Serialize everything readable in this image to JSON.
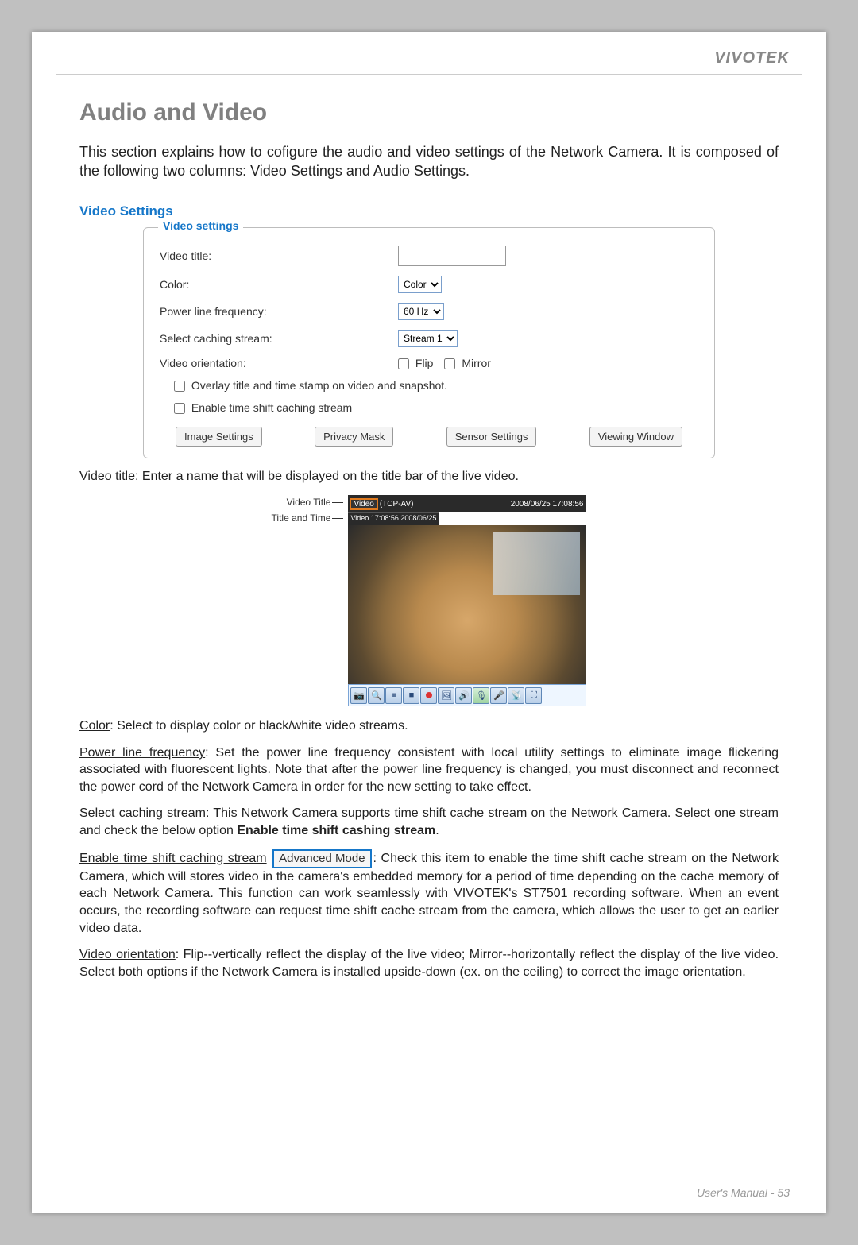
{
  "brand": "VIVOTEK",
  "h1": "Audio and Video",
  "intro": "This section explains how to cofigure the audio and video settings of the Network Camera. It is composed of the following two columns: Video Settings and Audio Settings.",
  "subhead": "Video Settings",
  "legend": "Video settings",
  "labels": {
    "video_title": "Video title:",
    "color": "Color:",
    "plf": "Power line frequency:",
    "caching": "Select caching stream:",
    "orientation": "Video orientation:",
    "flip": "Flip",
    "mirror": "Mirror",
    "overlay": "Overlay title and time stamp on video and snapshot.",
    "enable_ts": "Enable time shift caching stream"
  },
  "selects": {
    "color": "Color",
    "plf": "60 Hz",
    "caching": "Stream 1"
  },
  "buttons": {
    "image": "Image Settings",
    "privacy": "Privacy Mask",
    "sensor": "Sensor Settings",
    "viewing": "Viewing Window"
  },
  "figure": {
    "label_title": "Video Title",
    "label_titletime": "Title and Time",
    "overlay_title": "Video",
    "overlay_proto": "(TCP-AV)",
    "overlay_timestamp": "2008/06/25 17:08:56",
    "second_overlay": "Video 17:08:56 2008/06/25"
  },
  "paras": {
    "video_title_u": "Video title",
    "video_title_t": ": Enter a name that will be displayed on the title bar of the live video.",
    "color_u": "Color",
    "color_t": ": Select to display color or black/white video streams.",
    "plf_u": "Power line frequency",
    "plf_t": ": Set the power line frequency consistent with local utility settings to eliminate image flickering associated with fluorescent lights. Note that after the power line frequency is changed, you must disconnect and reconnect the power cord of the Network Camera in order for the new setting to take effect.",
    "sel_u": "Select caching stream",
    "sel_t1": ": This Network Camera supports time shift cache stream on the Network Camera. Select one stream and check the below option ",
    "sel_b": "Enable time shift cashing stream",
    "sel_t2": ".",
    "ets_u": "Enable time shift caching stream",
    "adv": "Advanced Mode",
    "ets_t": ": Check this item to enable the time shift cache stream on the Network Camera, which will stores video in the camera's embedded memory for a period of time depending on the cache memory of each Network Camera. This function can work seamlessly with VIVOTEK's ST7501 recording software. When an event occurs, the recording software can request time shift cache stream from the camera, which allows the user to get an earlier video data.",
    "vo_u": "Video orientation",
    "vo_t": ": Flip--vertically reflect the display of the live video; Mirror--horizontally reflect the display of the live video. Select both options if the Network Camera is installed upside-down (ex. on the ceiling) to correct the image orientation."
  },
  "footer": {
    "label": "User's Manual - ",
    "page": "53"
  }
}
